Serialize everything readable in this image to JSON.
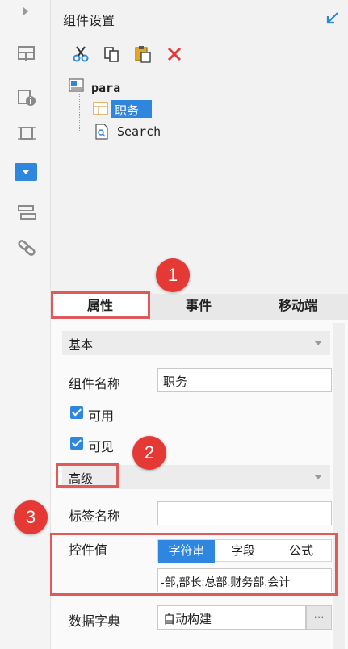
{
  "header": {
    "title": "组件设置",
    "collapse_icon": "arrow-down-left-icon"
  },
  "toolbar": {
    "icons": [
      "cut-icon",
      "copy-icon",
      "paste-icon",
      "delete-icon"
    ]
  },
  "tree": {
    "root": "para",
    "children": [
      "职务",
      "Search"
    ]
  },
  "tabs": [
    "属性",
    "事件",
    "移动端"
  ],
  "panel": {
    "basic_section": "基本",
    "name_label": "组件名称",
    "name_value": "职务",
    "enabled_label": "可用",
    "visible_label": "可见",
    "advanced_section": "高级",
    "tag_label": "标签名称",
    "tag_value": "",
    "control_value_label": "控件值",
    "control_value_tabs": [
      "字符串",
      "字段",
      "公式"
    ],
    "control_value_text": "-部,部长;总部,财务部,会计",
    "dict_label": "数据字典",
    "dict_value": "自动构建",
    "dict_button": "···"
  },
  "badges": [
    "1",
    "2",
    "3"
  ],
  "colors": {
    "accent": "#2e86de",
    "badge": "#e53935",
    "highlight_box": "#e05a5a"
  }
}
